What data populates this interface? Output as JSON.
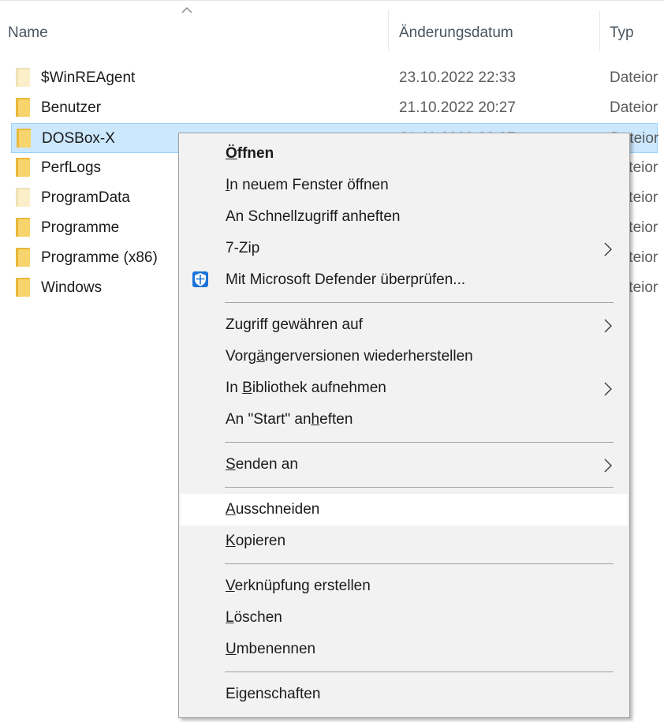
{
  "columns": {
    "name": "Name",
    "date": "Änderungsdatum",
    "type": "Typ"
  },
  "files": [
    {
      "name": "$WinREAgent",
      "date": "23.10.2022 22:33",
      "type": "Dateior",
      "icon": "folder-pale-icon",
      "selected": false
    },
    {
      "name": "Benutzer",
      "date": "21.10.2022 20:27",
      "type": "Dateior",
      "icon": "folder-icon",
      "selected": false
    },
    {
      "name": "DOSBox-X",
      "date": "01.11.2022 20:07",
      "type": "Dateior",
      "icon": "folder-icon",
      "selected": true
    },
    {
      "name": "PerfLogs",
      "date": "",
      "type": "Dateior",
      "icon": "folder-icon",
      "selected": false
    },
    {
      "name": "ProgramData",
      "date": "",
      "type": "Dateior",
      "icon": "folder-pale-icon",
      "selected": false
    },
    {
      "name": "Programme",
      "date": "",
      "type": "Dateior",
      "icon": "folder-icon",
      "selected": false
    },
    {
      "name": "Programme (x86)",
      "date": "",
      "type": "Dateior",
      "icon": "folder-icon",
      "selected": false
    },
    {
      "name": "Windows",
      "date": "",
      "type": "Dateior",
      "icon": "folder-icon",
      "selected": false
    }
  ],
  "context_menu": {
    "groups": [
      [
        {
          "pre": "",
          "u": "Ö",
          "post": "ffnen",
          "bold": true,
          "submenu": false
        },
        {
          "pre": "",
          "u": "I",
          "post": "n neuem Fenster öffnen",
          "bold": false,
          "submenu": false
        },
        {
          "pre": "An Schnellzugriff anheften",
          "u": "",
          "post": "",
          "bold": false,
          "submenu": false
        },
        {
          "pre": "7-Zip",
          "u": "",
          "post": "",
          "bold": false,
          "submenu": true
        },
        {
          "pre": "Mit Microsoft Defender überprüfen...",
          "u": "",
          "post": "",
          "bold": false,
          "submenu": false,
          "icon": "defender-shield-icon"
        }
      ],
      [
        {
          "pre": "Zu",
          "u": "g",
          "post": "riff gewähren auf",
          "bold": false,
          "submenu": true
        },
        {
          "pre": "Vorg",
          "u": "ä",
          "post": "ngerversionen wiederherstellen",
          "bold": false,
          "submenu": false
        },
        {
          "pre": "In ",
          "u": "B",
          "post": "ibliothek aufnehmen",
          "bold": false,
          "submenu": true
        },
        {
          "pre": "An \"Start\" an",
          "u": "h",
          "post": "eften",
          "bold": false,
          "submenu": false
        }
      ],
      [
        {
          "pre": "",
          "u": "S",
          "post": "enden an",
          "bold": false,
          "submenu": true
        }
      ],
      [
        {
          "pre": "",
          "u": "A",
          "post": "usschneiden",
          "bold": false,
          "submenu": false,
          "hover": true
        },
        {
          "pre": "",
          "u": "K",
          "post": "opieren",
          "bold": false,
          "submenu": false
        }
      ],
      [
        {
          "pre": "",
          "u": "V",
          "post": "erknüpfung erstellen",
          "bold": false,
          "submenu": false
        },
        {
          "pre": "",
          "u": "L",
          "post": "öschen",
          "bold": false,
          "submenu": false
        },
        {
          "pre": "",
          "u": "U",
          "post": "mbenennen",
          "bold": false,
          "submenu": false
        }
      ],
      [
        {
          "pre": "Ei",
          "u": "g",
          "post": "enschaften",
          "bold": false,
          "submenu": false
        }
      ]
    ]
  },
  "colors": {
    "selection_bg": "#cce8ff",
    "selection_border": "#99d1ff",
    "menu_bg": "#f2f2f2",
    "folder": "#f8d46c",
    "defender_blue": "#1a73d9"
  }
}
